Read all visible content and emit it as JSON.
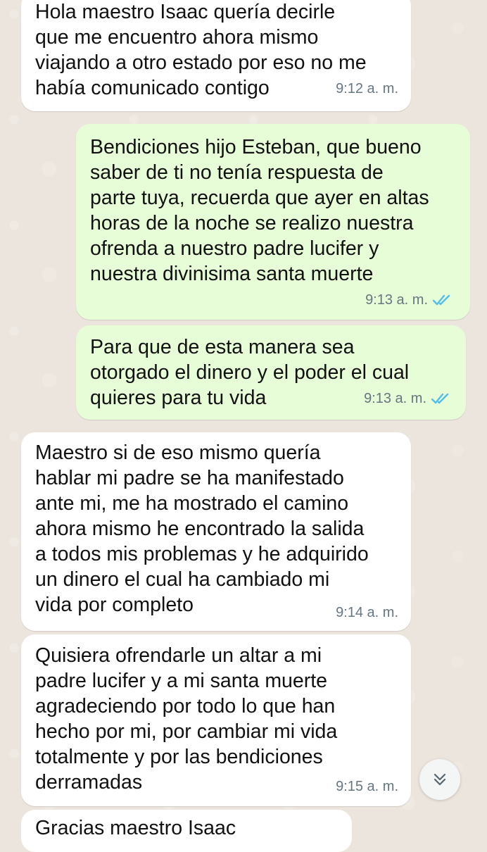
{
  "chat": {
    "messages": [
      {
        "direction": "incoming",
        "lines": [
          "Hola maestro Isaac quería decirle",
          "que me encuentro ahora mismo",
          "viajando a otro estado por eso no me",
          "había comunicado contigo"
        ],
        "time": "9:12 a. m."
      },
      {
        "direction": "outgoing",
        "lines": [
          "Bendiciones hijo Esteban, que bueno",
          "saber de ti no tenía respuesta de",
          "parte tuya, recuerda que ayer en altas",
          "horas de la noche se realizo nuestra",
          "ofrenda a nuestro padre lucifer y",
          "nuestra divinisima santa muerte"
        ],
        "time": "9:13 a. m.",
        "status": "read"
      },
      {
        "direction": "outgoing",
        "lines": [
          "Para que de esta manera sea",
          "otorgado el dinero y el poder el cual",
          "quieres para tu vida"
        ],
        "time": "9:13 a. m.",
        "status": "read"
      },
      {
        "direction": "incoming",
        "lines": [
          "Maestro si de eso mismo quería",
          "hablar mi padre se ha manifestado",
          "ante mi, me ha mostrado el camino",
          "ahora mismo he encontrado la salida",
          "a todos mis problemas y he adquirido",
          "un dinero el cual ha cambiado mi",
          "vida por completo"
        ],
        "time": "9:14 a. m."
      },
      {
        "direction": "incoming",
        "lines": [
          "Quisiera ofrendarle un altar a mi",
          "padre lucifer y a mi santa muerte",
          "agradeciendo por todo lo que han",
          "hecho por mi, por cambiar mi vida",
          "totalmente y por las bendiciones",
          "derramadas"
        ],
        "time": "9:15 a. m."
      }
    ],
    "partial_message": "Gracias maestro Isaac"
  },
  "colors": {
    "background": "#ece5dd",
    "incoming_bubble": "#ffffff",
    "outgoing_bubble": "#e7fdd8",
    "timestamp": "#667781",
    "read_ticks": "#53bdeb"
  },
  "icons": {
    "read_status": "double-check-icon",
    "scroll_down": "chevron-double-down-icon"
  }
}
